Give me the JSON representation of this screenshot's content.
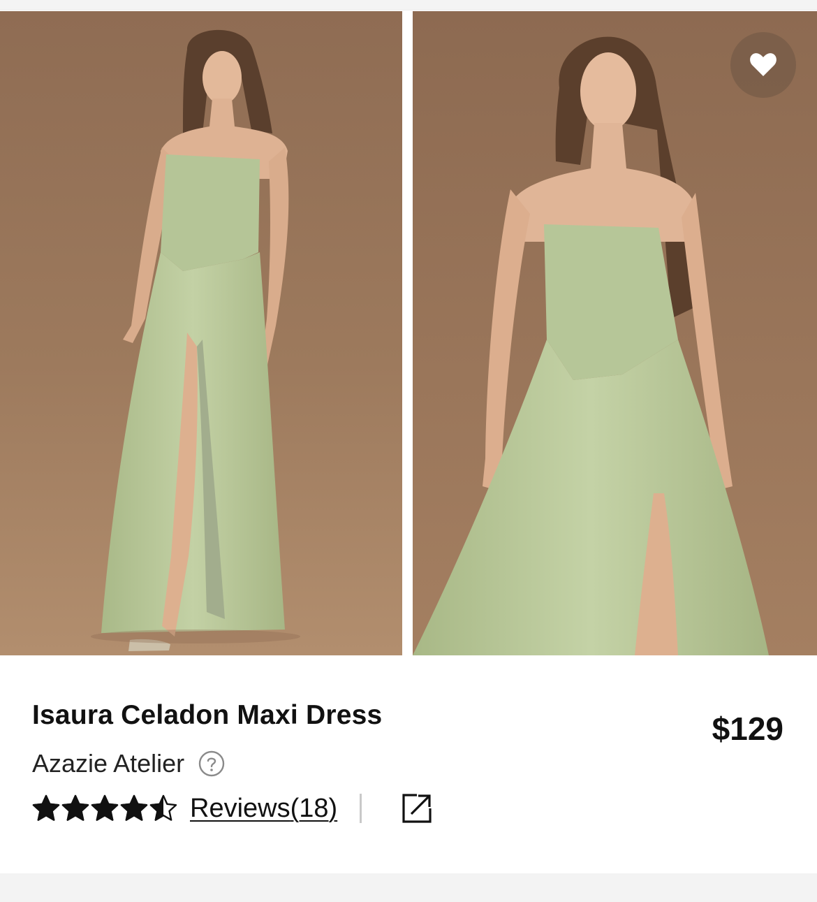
{
  "gallery": {
    "images": [
      {
        "alt": "model-full-length-front"
      },
      {
        "alt": "model-three-quarter-front"
      }
    ],
    "favorite_icon": "heart-icon"
  },
  "product": {
    "title": "Isaura Celadon Maxi Dress",
    "price": "$129",
    "brand": "Azazie Atelier",
    "help_icon": "question-circle-icon",
    "rating": 4.5,
    "rating_max": 5,
    "reviews_label": "Reviews",
    "reviews_count": "(18)",
    "share_icon": "external-link-icon"
  },
  "colors": {
    "backdrop": "#9a7658",
    "dress": "#b9c89a",
    "text": "#111111",
    "fav_bg": "#6e5544"
  }
}
